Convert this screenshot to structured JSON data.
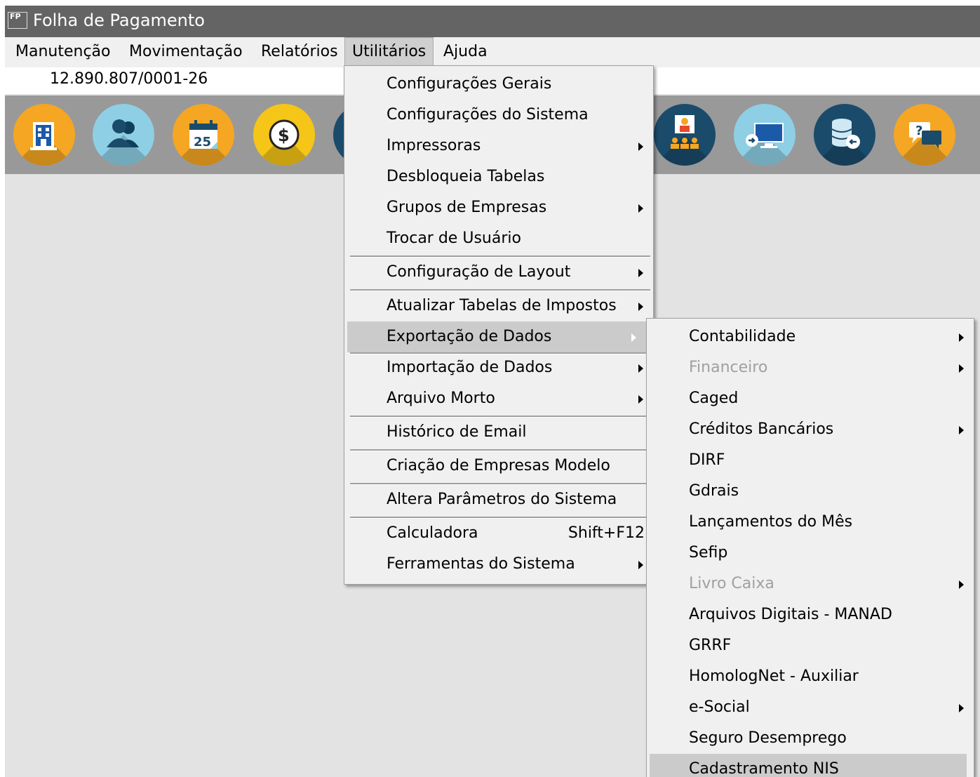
{
  "window": {
    "icon_text": "FP",
    "title": "Folha de Pagamento"
  },
  "menubar": [
    {
      "label": "Manutenção"
    },
    {
      "label": "Movimentação"
    },
    {
      "label": "Relatórios"
    },
    {
      "label": "Utilitários"
    },
    {
      "label": "Ajuda"
    }
  ],
  "company": {
    "cnpj": "12.890.807/0001-26"
  },
  "toolbar": [
    {
      "name": "company-icon",
      "color": "#f5a623"
    },
    {
      "name": "employees-icon",
      "color": "#8ecfe6"
    },
    {
      "name": "calendar-icon",
      "color": "#f5a623"
    },
    {
      "name": "payment-icon",
      "color": "#f5c518"
    },
    {
      "name": "meeting-icon",
      "color": "#1b4b6b"
    },
    {
      "name": "remote-screen-icon",
      "color": "#8ecfe6"
    },
    {
      "name": "database-restore-icon",
      "color": "#1b4b6b"
    },
    {
      "name": "help-chat-icon",
      "color": "#f5a623"
    }
  ],
  "utilitarios_menu": [
    {
      "label": "Configurações Gerais"
    },
    {
      "label": "Configurações do Sistema"
    },
    {
      "label": "Impressoras",
      "submenu": true
    },
    {
      "label": "Desbloqueia Tabelas"
    },
    {
      "label": "Grupos de Empresas",
      "submenu": true
    },
    {
      "label": "Trocar de Usuário"
    },
    {
      "label": "Configuração de Layout",
      "submenu": true
    },
    {
      "label": "Atualizar Tabelas de Impostos",
      "submenu": true
    },
    {
      "label": "Exportação de Dados",
      "submenu": true
    },
    {
      "label": "Importação de Dados",
      "submenu": true
    },
    {
      "label": "Arquivo Morto",
      "submenu": true
    },
    {
      "label": "Histórico de Email"
    },
    {
      "label": "Criação de Empresas Modelo"
    },
    {
      "label": "Altera Parâmetros do Sistema"
    },
    {
      "label": "Calculadora",
      "shortcut": "Shift+F12"
    },
    {
      "label": "Ferramentas do Sistema",
      "submenu": true
    }
  ],
  "exportacao_menu": [
    {
      "label": "Contabilidade",
      "submenu": true
    },
    {
      "label": "Financeiro",
      "submenu": true,
      "disabled": true
    },
    {
      "label": "Caged"
    },
    {
      "label": "Créditos Bancários",
      "submenu": true
    },
    {
      "label": "DIRF"
    },
    {
      "label": "Gdrais"
    },
    {
      "label": "Lançamentos do Mês"
    },
    {
      "label": "Sefip"
    },
    {
      "label": "Livro Caixa",
      "submenu": true,
      "disabled": true
    },
    {
      "label": "Arquivos Digitais - MANAD"
    },
    {
      "label": "GRRF"
    },
    {
      "label": "HomologNet - Auxiliar"
    },
    {
      "label": "e-Social",
      "submenu": true
    },
    {
      "label": "Seguro Desemprego"
    },
    {
      "label": "Cadastramento NIS"
    }
  ]
}
